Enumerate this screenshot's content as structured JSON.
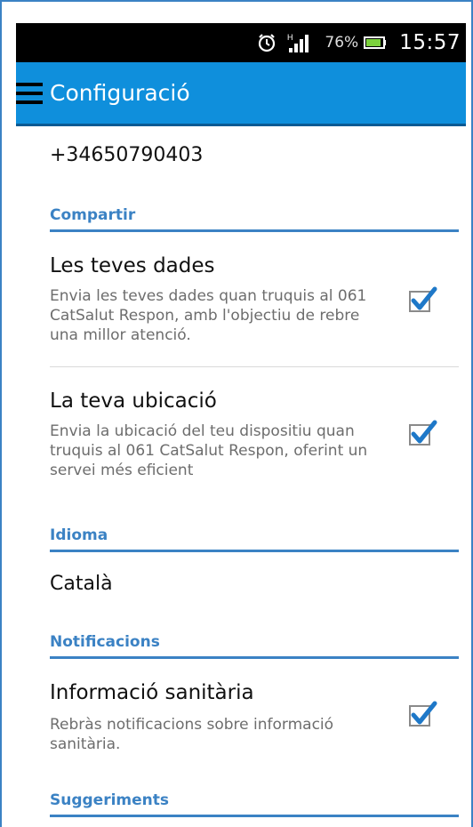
{
  "status_bar": {
    "battery_percent": "76%",
    "time": "15:57",
    "icons": [
      "alarm-icon",
      "signal-icon",
      "battery-icon"
    ]
  },
  "app_bar": {
    "title": "Configuració",
    "menu_icon": "menu-icon"
  },
  "phone": "+34650790403",
  "sections": {
    "compartir": {
      "title": "Compartir",
      "items": [
        {
          "title": "Les teves dades",
          "summary": "Envia les teves dades quan truquis al 061 CatSalut Respon, amb l'objectiu de rebre una millor atenció.",
          "checked": true
        },
        {
          "title": "La teva ubicació",
          "summary": "Envia la ubicació del teu dispositiu quan truquis al 061 CatSalut Respon, oferint un servei més eficient",
          "checked": true
        }
      ]
    },
    "idioma": {
      "title": "Idioma",
      "value": "Català"
    },
    "notificacions": {
      "title": "Notificacions",
      "items": [
        {
          "title": "Informació sanitària",
          "summary": "Rebràs notificacions sobre informació sanitària.",
          "checked": true
        }
      ]
    },
    "suggeriments": {
      "title": "Suggeriments"
    }
  },
  "colors": {
    "accent": "#3b82c4",
    "app_bar": "#0f8fdc",
    "checkbox_tick": "#1e78c8"
  }
}
